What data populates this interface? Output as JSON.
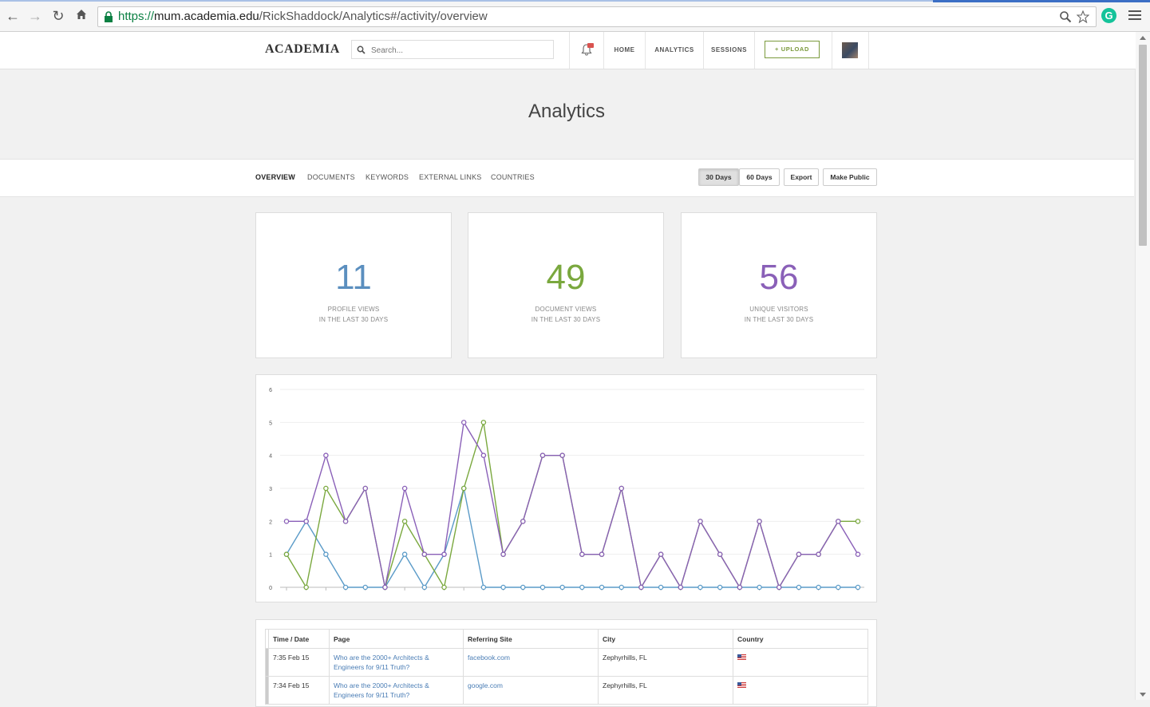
{
  "browser": {
    "url_scheme": "https://",
    "url_host": "mum.academia.edu",
    "url_path": "/RickShaddock/Analytics#/activity/overview",
    "extension_letter": "G"
  },
  "header": {
    "logo": "ACADEMIA",
    "search_placeholder": "Search...",
    "nav": [
      "HOME",
      "ANALYTICS",
      "SESSIONS"
    ],
    "upload_label": "+ UPLOAD"
  },
  "page_title": "Analytics",
  "subnav": {
    "tabs": [
      "OVERVIEW",
      "DOCUMENTS",
      "KEYWORDS",
      "EXTERNAL LINKS",
      "COUNTRIES"
    ],
    "active_tab": "OVERVIEW",
    "buttons": [
      "30 Days",
      "60 Days",
      "Export",
      "Make Public"
    ],
    "active_range": "30 Days"
  },
  "stats": [
    {
      "value": "11",
      "label1": "PROFILE VIEWS",
      "label2": "IN THE LAST 30 DAYS",
      "color": "#5b8fbf"
    },
    {
      "value": "49",
      "label1": "DOCUMENT VIEWS",
      "label2": "IN THE LAST 30 DAYS",
      "color": "#7aa83e"
    },
    {
      "value": "56",
      "label1": "UNIQUE VISITORS",
      "label2": "IN THE LAST 30 DAYS",
      "color": "#8a60b8"
    }
  ],
  "chart_data": {
    "type": "line",
    "ylim": [
      0,
      6
    ],
    "yticks": [
      "0",
      "1",
      "2",
      "3",
      "4",
      "5",
      "6"
    ],
    "grid": true,
    "x_count": 30,
    "series": [
      {
        "color": "#5b9bc8",
        "values": [
          1,
          2,
          1,
          0,
          0,
          0,
          1,
          0,
          1,
          3,
          0,
          0,
          0,
          0,
          0,
          0,
          0,
          0,
          0,
          0,
          0,
          0,
          0,
          0,
          0,
          0,
          0,
          0,
          0,
          0
        ]
      },
      {
        "color": "#7aa83e",
        "values": [
          1,
          0,
          3,
          2,
          3,
          0,
          2,
          1,
          0,
          3,
          5,
          1,
          2,
          4,
          4,
          1,
          1,
          3,
          0,
          1,
          0,
          2,
          1,
          0,
          2,
          0,
          1,
          1,
          2,
          2
        ]
      },
      {
        "color": "#8a60b8",
        "values": [
          2,
          2,
          4,
          2,
          3,
          0,
          3,
          1,
          1,
          5,
          4,
          1,
          2,
          4,
          4,
          1,
          1,
          3,
          0,
          1,
          0,
          2,
          1,
          0,
          2,
          0,
          1,
          1,
          2,
          1
        ]
      }
    ]
  },
  "table": {
    "headers": [
      "Time / Date",
      "Page",
      "Referring Site",
      "City",
      "Country"
    ],
    "rows": [
      {
        "time": "7:35 Feb 15",
        "page": "Who are the 2000+ Architects & Engineers for 9/11 Truth?",
        "site": "facebook.com",
        "city": "Zephyrhills, FL"
      },
      {
        "time": "7:34 Feb 15",
        "page": "Who are the 2000+ Architects & Engineers for 9/11 Truth?",
        "site": "google.com",
        "city": "Zephyrhills, FL"
      }
    ]
  }
}
